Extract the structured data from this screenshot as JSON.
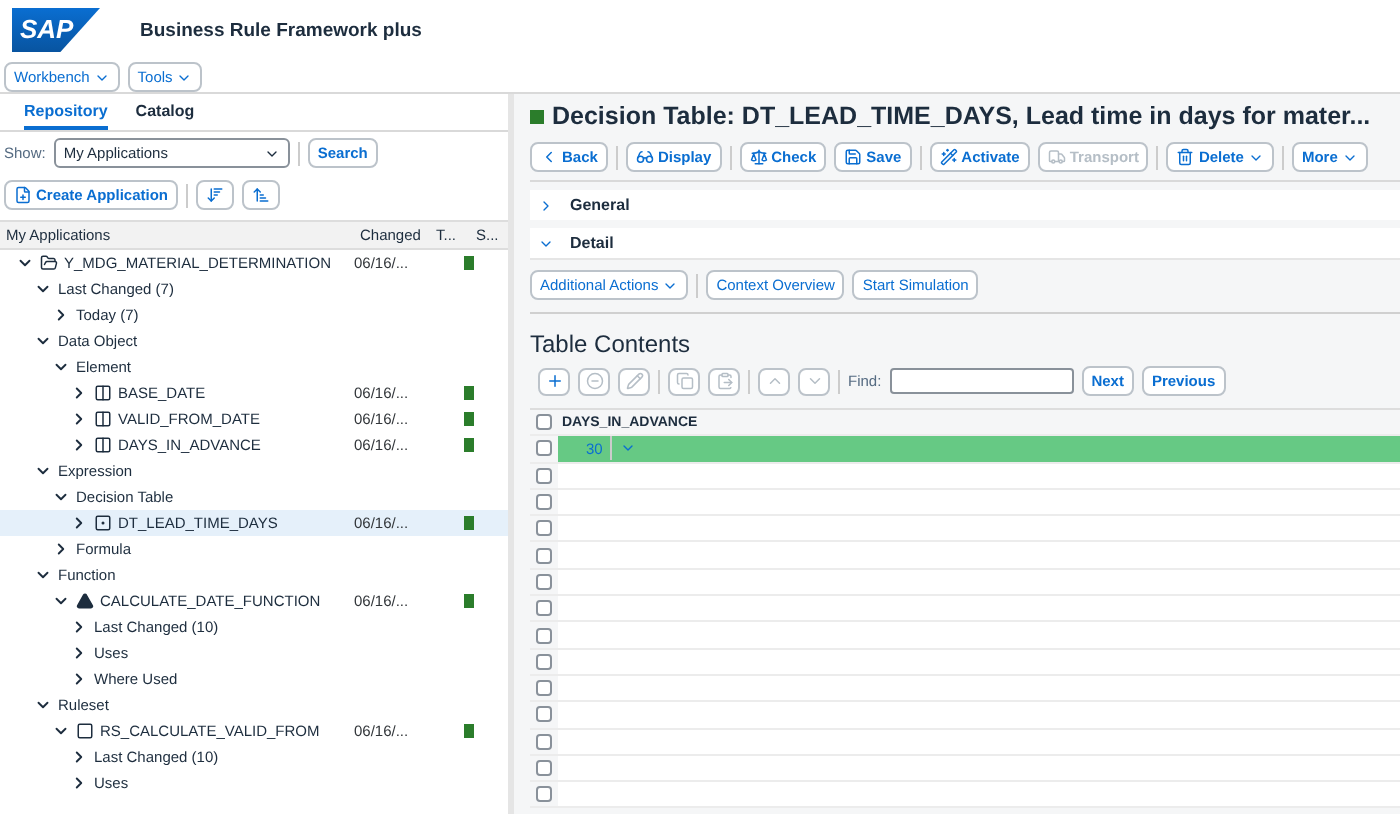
{
  "header": {
    "logo": "SAP",
    "title": "Business Rule Framework plus"
  },
  "menus": [
    {
      "label": "Workbench"
    },
    {
      "label": "Tools"
    }
  ],
  "left": {
    "tabs": [
      {
        "label": "Repository",
        "selected": true
      },
      {
        "label": "Catalog",
        "selected": false
      }
    ],
    "show_label": "Show:",
    "show_value": "My Applications",
    "search_button": "Search",
    "create_button": "Create Application",
    "columns": [
      "My Applications",
      "Changed",
      "T...",
      "S..."
    ],
    "tree": [
      {
        "label": "Y_MDG_MATERIAL_DETERMINATION",
        "kind": "application",
        "expanded": true,
        "changed": "06/16/...",
        "active": true,
        "selected": false,
        "children": [
          {
            "label": "Last Changed (7)",
            "expanded": true,
            "selected": false,
            "children": [
              {
                "label": "Today (7)",
                "expanded": false,
                "selected": false
              }
            ]
          },
          {
            "label": "Data Object",
            "expanded": true,
            "selected": false,
            "children": [
              {
                "label": "Element",
                "expanded": true,
                "selected": false,
                "children": [
                  {
                    "label": "BASE_DATE",
                    "kind": "element",
                    "expanded": false,
                    "changed": "06/16/...",
                    "active": true,
                    "selected": false
                  },
                  {
                    "label": "VALID_FROM_DATE",
                    "kind": "element",
                    "expanded": false,
                    "changed": "06/16/...",
                    "active": true,
                    "selected": false
                  },
                  {
                    "label": "DAYS_IN_ADVANCE",
                    "kind": "element",
                    "expanded": false,
                    "changed": "06/16/...",
                    "active": true,
                    "selected": false
                  }
                ]
              }
            ]
          },
          {
            "label": "Expression",
            "expanded": true,
            "selected": false,
            "children": [
              {
                "label": "Decision Table",
                "expanded": true,
                "selected": false,
                "children": [
                  {
                    "label": "DT_LEAD_TIME_DAYS",
                    "kind": "decision_table",
                    "expanded": false,
                    "changed": "06/16/...",
                    "active": true,
                    "selected": true
                  }
                ]
              },
              {
                "label": "Formula",
                "expanded": false,
                "selected": false
              }
            ]
          },
          {
            "label": "Function",
            "expanded": true,
            "selected": false,
            "children": [
              {
                "label": "CALCULATE_DATE_FUNCTION",
                "kind": "function",
                "expanded": true,
                "changed": "06/16/...",
                "active": true,
                "selected": false,
                "children": [
                  {
                    "label": "Last Changed (10)",
                    "expanded": false,
                    "selected": false
                  },
                  {
                    "label": "Uses",
                    "expanded": false,
                    "selected": false
                  },
                  {
                    "label": "Where Used",
                    "expanded": false,
                    "selected": false
                  }
                ]
              }
            ]
          },
          {
            "label": "Ruleset",
            "expanded": true,
            "selected": false,
            "children": [
              {
                "label": "RS_CALCULATE_VALID_FROM",
                "kind": "ruleset",
                "expanded": true,
                "changed": "06/16/...",
                "active": true,
                "selected": false,
                "children": [
                  {
                    "label": "Last Changed (10)",
                    "expanded": false,
                    "selected": false
                  },
                  {
                    "label": "Uses",
                    "expanded": false,
                    "selected": false
                  }
                ]
              }
            ]
          }
        ]
      }
    ]
  },
  "main": {
    "title": "Decision Table: DT_LEAD_TIME_DAYS, Lead time in days for mater...",
    "active": true,
    "toolbar": [
      {
        "kind": "back",
        "label": "Back",
        "disabled": false
      },
      {
        "kind": "display",
        "label": "Display",
        "disabled": false
      },
      {
        "kind": "check",
        "label": "Check",
        "disabled": false
      },
      {
        "kind": "save",
        "label": "Save",
        "disabled": false
      },
      {
        "kind": "activate",
        "label": "Activate",
        "disabled": false
      },
      {
        "kind": "transport",
        "label": "Transport",
        "disabled": true
      },
      {
        "kind": "delete",
        "label": "Delete",
        "disabled": false
      },
      {
        "kind": "more",
        "label": "More",
        "disabled": false
      }
    ],
    "sections": [
      {
        "label": "General",
        "expanded": false
      },
      {
        "label": "Detail",
        "expanded": true
      }
    ],
    "actions": [
      {
        "label": "Additional Actions",
        "menu": true
      },
      {
        "label": "Context Overview",
        "menu": false
      },
      {
        "label": "Start Simulation",
        "menu": false
      }
    ],
    "table_title": "Table Contents",
    "table_tools": [
      {
        "kind": "add",
        "disabled": false
      },
      {
        "kind": "remove",
        "disabled": true
      },
      {
        "kind": "edit",
        "disabled": true
      },
      {
        "kind": "copy",
        "disabled": true
      },
      {
        "kind": "paste",
        "disabled": true
      },
      {
        "kind": "up",
        "disabled": true
      },
      {
        "kind": "down",
        "disabled": true
      }
    ],
    "find_label": "Find:",
    "next_button": "Next",
    "previous_button": "Previous",
    "column": "DAYS_IN_ADVANCE",
    "all_checked": false,
    "rows": [
      {
        "value": "30",
        "highlighted": true,
        "checked": false
      },
      {
        "highlighted": false,
        "checked": false
      },
      {
        "highlighted": false,
        "checked": false
      },
      {
        "highlighted": false,
        "checked": false
      },
      {
        "highlighted": false,
        "checked": false
      },
      {
        "highlighted": false,
        "checked": false
      },
      {
        "highlighted": false,
        "checked": false
      },
      {
        "highlighted": false,
        "checked": false
      },
      {
        "highlighted": false,
        "checked": false
      },
      {
        "highlighted": false,
        "checked": false
      },
      {
        "highlighted": false,
        "checked": false
      },
      {
        "highlighted": false,
        "checked": false
      },
      {
        "highlighted": false,
        "checked": false
      },
      {
        "highlighted": false,
        "checked": false
      }
    ]
  }
}
